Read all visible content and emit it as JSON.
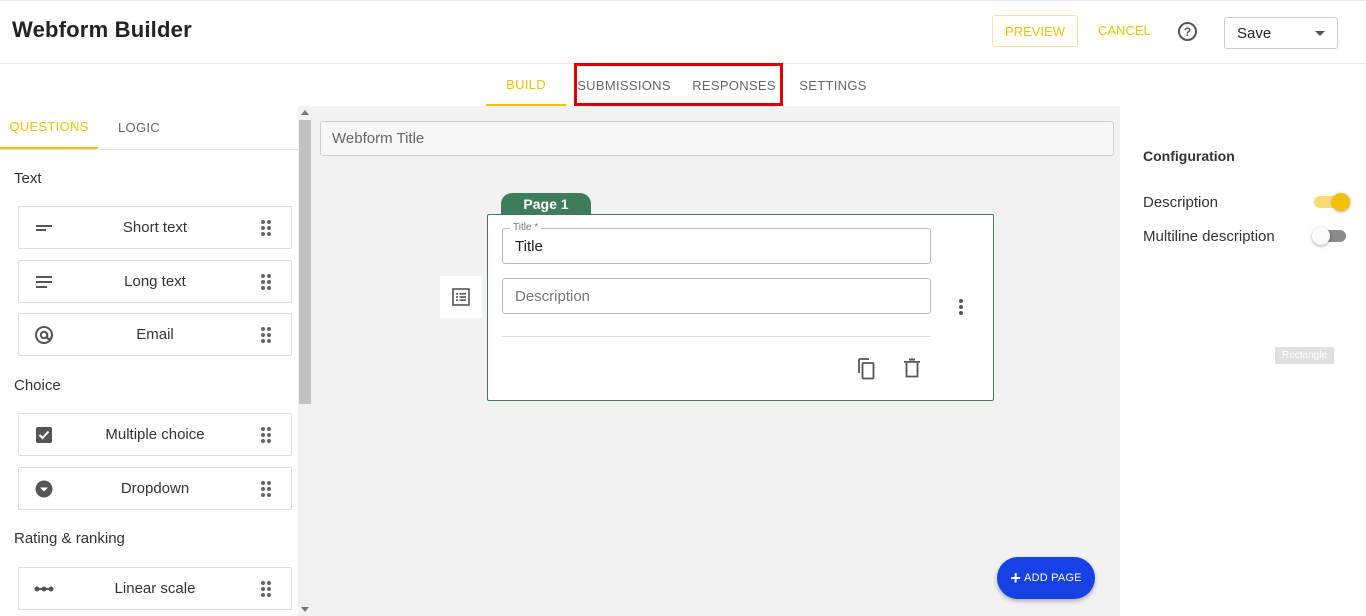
{
  "header": {
    "title": "Webform Builder",
    "preview_label": "PREVIEW",
    "cancel_label": "CANCEL",
    "help_glyph": "?",
    "save_label": "Save"
  },
  "main_tabs": [
    {
      "label": "BUILD",
      "active": true
    },
    {
      "label": "SUBMISSIONS",
      "active": false
    },
    {
      "label": "RESPONSES",
      "active": false
    },
    {
      "label": "SETTINGS",
      "active": false
    }
  ],
  "left_panel": {
    "tabs": [
      {
        "label": "QUESTIONS",
        "active": true
      },
      {
        "label": "LOGIC",
        "active": false
      }
    ],
    "sections": [
      {
        "label": "Text",
        "items": [
          {
            "label": "Short text",
            "icon": "short-text-icon"
          },
          {
            "label": "Long text",
            "icon": "long-text-icon"
          },
          {
            "label": "Email",
            "icon": "at-sign-icon"
          }
        ]
      },
      {
        "label": "Choice",
        "items": [
          {
            "label": "Multiple choice",
            "icon": "checkbox-icon"
          },
          {
            "label": "Dropdown",
            "icon": "dropdown-circle-icon"
          }
        ]
      },
      {
        "label": "Rating & ranking",
        "items": [
          {
            "label": "Linear scale",
            "icon": "linear-scale-icon"
          }
        ]
      }
    ]
  },
  "canvas": {
    "webform_title_placeholder": "Webform Title",
    "page_tab_label": "Page 1",
    "title_field_legend": "Title *",
    "title_field_value": "Title",
    "description_placeholder": "Description",
    "add_page_plus": "+",
    "add_page_label": "ADD PAGE"
  },
  "config": {
    "title": "Configuration",
    "description_label": "Description",
    "description_on": true,
    "multiline_label": "Multiline description",
    "multiline_on": false,
    "rect_tag": "Rectangle"
  },
  "colors": {
    "accent": "#f5c000",
    "page_green": "#3e7d5a",
    "add_page_blue": "#1641e6",
    "highlight_red": "#e00000"
  }
}
